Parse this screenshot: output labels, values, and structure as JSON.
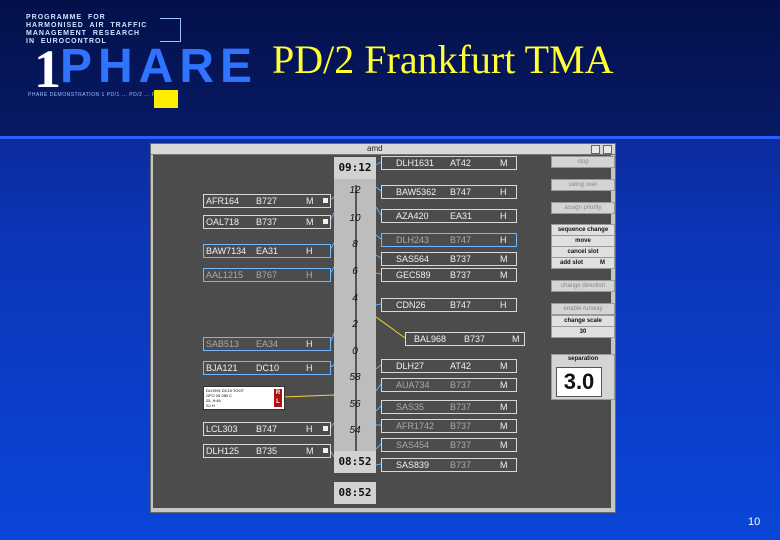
{
  "header": {
    "logo_lines": [
      "PROGRAMME  FOR",
      "HARMONISED  AIR  TRAFFIC",
      "MANAGEMENT  RESEARCH",
      "IN  EUROCONTROL"
    ],
    "logo_word": "PHARE",
    "logo_numeral": "1",
    "logo_footer": "PHARE DEMONSTRATION  1  PD/1 ... PD/2 ... PD/3",
    "title": "PD/2 Frankfurt TMA"
  },
  "window": {
    "title": "amd",
    "close_glyph": "x"
  },
  "ladder": {
    "top_time": "09:12",
    "bottom_time": "08:52",
    "footer_time": "08:52",
    "ticks": [
      "12",
      "10",
      "8",
      "6",
      "4",
      "2",
      "0",
      "58",
      "56",
      "54"
    ]
  },
  "left_strips": [
    {
      "callsign": "AFR164",
      "type": "B727",
      "wake": "M"
    },
    {
      "callsign": "OAL718",
      "type": "B737",
      "wake": "M"
    },
    {
      "callsign": "BAW7134",
      "type": "EA31",
      "wake": "H"
    },
    {
      "callsign": "AAL1215",
      "type": "B767",
      "wake": "H"
    },
    {
      "callsign": "SAB513",
      "type": "EA34",
      "wake": "H"
    },
    {
      "callsign": "BJA121",
      "type": "DC10",
      "wake": "H"
    },
    {
      "callsign": "LCL303",
      "type": "B747",
      "wake": "H"
    },
    {
      "callsign": "DLH125",
      "type": "B735",
      "wake": "M"
    }
  ],
  "right_strips": [
    {
      "callsign": "DLH1631",
      "type": "AT42",
      "wake": "M"
    },
    {
      "callsign": "BAW5362",
      "type": "B747",
      "wake": "H"
    },
    {
      "callsign": "AZA420",
      "type": "EA31",
      "wake": "H"
    },
    {
      "callsign": "DLH243",
      "type": "B747",
      "wake": "H"
    },
    {
      "callsign": "SAS564",
      "type": "B737",
      "wake": "M"
    },
    {
      "callsign": "GEC589",
      "type": "B737",
      "wake": "M"
    },
    {
      "callsign": "CDN26",
      "type": "B747",
      "wake": "H"
    },
    {
      "callsign": "BAL968",
      "type": "B737",
      "wake": "M"
    },
    {
      "callsign": "DLH27",
      "type": "AT42",
      "wake": "M"
    },
    {
      "callsign": "AUA734",
      "type": "B737",
      "wake": "M"
    },
    {
      "callsign": "SAS35",
      "type": "B737",
      "wake": "M"
    },
    {
      "callsign": "AFR1742",
      "type": "B737",
      "wake": "M"
    },
    {
      "callsign": "SAS454",
      "type": "B737",
      "wake": "M"
    },
    {
      "callsign": "SAS839",
      "type": "B737",
      "wake": "M"
    }
  ],
  "mini_label": {
    "line1": "DLH291   DC10  TOOT",
    "line2": "GFO    25  280    C",
    "line3": "         25    -9:46",
    "line4": "          SJ    H",
    "flag_top": "R",
    "flag_bottom": "L"
  },
  "buttons": {
    "stop": "stop",
    "swing_over": "swing over",
    "assign_priority": "assign priority",
    "sequence_change": "sequence change",
    "move": "move",
    "cancel_slot": "cancel slot",
    "add_slot": "add slot",
    "add_slot_wake": "M",
    "change_direction": "change direction",
    "enable_runway": "enable runway",
    "change_scale": "change scale",
    "scale_value": "30"
  },
  "separation": {
    "label": "separation",
    "value": "3.0"
  },
  "page_number": "10",
  "colors": {
    "accent": "#ffff33",
    "strip_link": "#5ab0ff",
    "selected_link": "#ffcc33"
  }
}
